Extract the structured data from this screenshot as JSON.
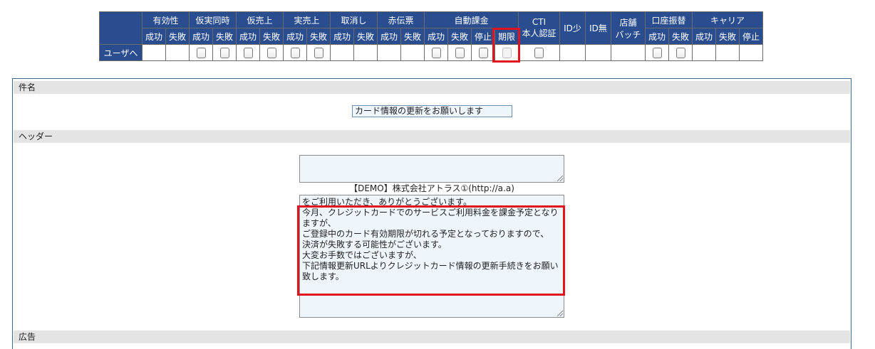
{
  "matrix": {
    "groups": [
      {
        "label": "",
        "span": 1
      },
      {
        "label": "有効性",
        "span": 2
      },
      {
        "label": "仮実同時",
        "span": 2
      },
      {
        "label": "仮売上",
        "span": 2
      },
      {
        "label": "実売上",
        "span": 2
      },
      {
        "label": "取消し",
        "span": 2
      },
      {
        "label": "赤伝票",
        "span": 2
      },
      {
        "label": "自動課金",
        "span": 4
      },
      {
        "label": "CTI",
        "sub": "本人認証",
        "span": 1,
        "tall": true
      },
      {
        "label": "ID少",
        "span": 1,
        "tall": true
      },
      {
        "label": "ID無",
        "span": 1,
        "tall": true
      },
      {
        "label": "店舗",
        "sub": "バッチ",
        "span": 1,
        "tall": true
      },
      {
        "label": "口座振替",
        "span": 2
      },
      {
        "label": "キャリア",
        "span": 3
      }
    ],
    "subheaders": [
      "成功",
      "失敗",
      "成功",
      "失敗",
      "成功",
      "失敗",
      "成功",
      "失敗",
      "成功",
      "失敗",
      "成功",
      "失敗",
      "成功",
      "失敗",
      "停止",
      "期限",
      "成功",
      "失敗",
      "成功",
      "失敗",
      "停止"
    ],
    "row_label": "ユーザへ",
    "row_cells": [
      "empty",
      "empty",
      "cb",
      "cb",
      "cb",
      "cb",
      "cb",
      "cb",
      "empty",
      "empty",
      "empty",
      "empty",
      "cb",
      "cb",
      "cb",
      "cb-disabled",
      "cb",
      "empty",
      "empty",
      "empty",
      "cb",
      "cb",
      "empty",
      "empty",
      "empty"
    ]
  },
  "form": {
    "subject_label": "件名",
    "subject_value": "カード情報の更新をお願いします",
    "header_label": "ヘッダー",
    "sender_line": "【DEMO】株式会社アトラス①(http://a.a)",
    "body_lines": [
      "をご利用いただき、ありがとうございます。",
      "今月、クレジットカードでのサービスご利用料金を課金予定となりますが、",
      "ご登録中のカード有効期限が切れる予定となっておりますので、",
      "決済が失敗する可能性がございます。",
      "大変お手数ではございますが、",
      "下記情報更新URLよりクレジットカード情報の更新手続きをお願い致します。"
    ],
    "ad_label": "広告"
  },
  "colors": {
    "header_bg": "#2a4d8f",
    "highlight": "#e0141e",
    "input_bg": "#eef6fc",
    "section_bg": "#e4e4e4"
  }
}
